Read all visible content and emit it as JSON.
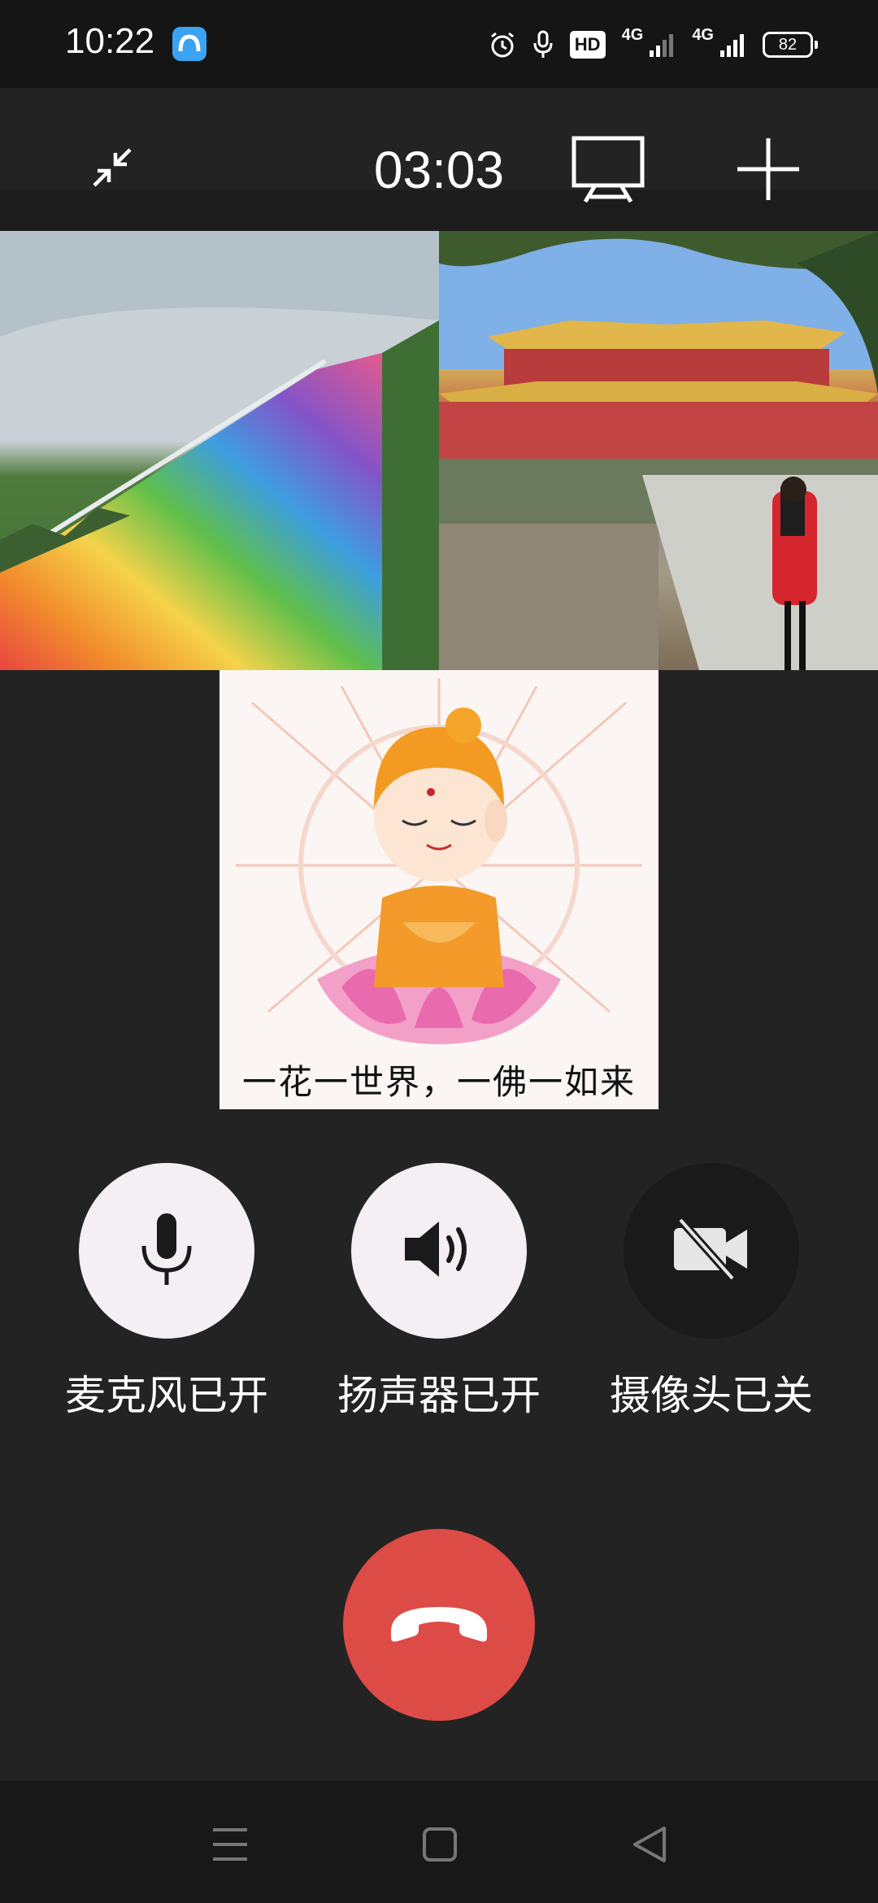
{
  "status_bar": {
    "time": "10:22",
    "hd_label": "HD",
    "network_1": "4G",
    "network_2": "4G",
    "battery": "82"
  },
  "toolbar": {
    "call_timer": "03:03",
    "icons": [
      "minimize-icon",
      "screen-share-icon",
      "add-icon"
    ]
  },
  "video_tiles": [
    {
      "name": "participant-rainbow-slide"
    },
    {
      "name": "participant-temple-photo"
    },
    {
      "name": "participant-buddha-image",
      "caption": "一花一世界，一佛一如来"
    }
  ],
  "controls": {
    "mic_label": "麦克风已开",
    "speaker_label": "扬声器已开",
    "camera_label": "摄像头已关"
  },
  "colors": {
    "background": "#232323",
    "control_on": "#f3eff2",
    "control_off": "#1a1a1a",
    "hangup": "#dd4b47"
  },
  "nav": {
    "icons": [
      "menu-icon",
      "home-icon",
      "back-icon"
    ]
  }
}
